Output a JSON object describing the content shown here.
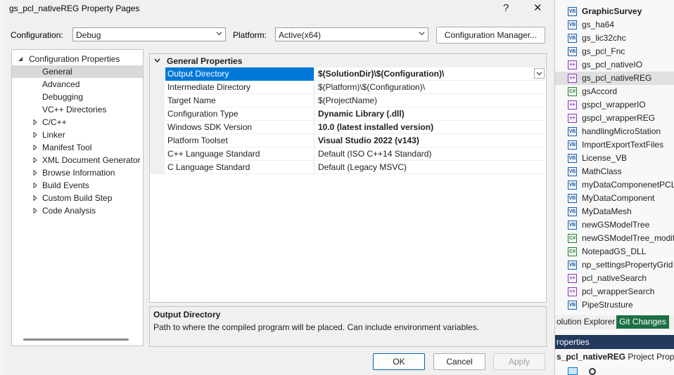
{
  "dialog": {
    "title": "gs_pcl_nativeREG Property Pages",
    "help": "?",
    "close": "✕",
    "configuration_label": "Configuration:",
    "configuration_value": "Debug",
    "platform_label": "Platform:",
    "platform_value": "Active(x64)",
    "config_manager": "Configuration Manager...",
    "ok": "OK",
    "cancel": "Cancel",
    "apply": "Apply"
  },
  "tree": {
    "root": "Configuration Properties",
    "items": [
      {
        "label": "General",
        "expandable": false,
        "selected": true
      },
      {
        "label": "Advanced",
        "expandable": false
      },
      {
        "label": "Debugging",
        "expandable": false
      },
      {
        "label": "VC++ Directories",
        "expandable": false
      },
      {
        "label": "C/C++",
        "expandable": true
      },
      {
        "label": "Linker",
        "expandable": true
      },
      {
        "label": "Manifest Tool",
        "expandable": true
      },
      {
        "label": "XML Document Generator",
        "expandable": true
      },
      {
        "label": "Browse Information",
        "expandable": true
      },
      {
        "label": "Build Events",
        "expandable": true
      },
      {
        "label": "Custom Build Step",
        "expandable": true
      },
      {
        "label": "Code Analysis",
        "expandable": true
      }
    ]
  },
  "grid": {
    "section": "General Properties",
    "rows": [
      {
        "name": "Output Directory",
        "value": "$(SolutionDir)\\$(Configuration)\\",
        "bold": true,
        "selected": true
      },
      {
        "name": "Intermediate Directory",
        "value": "$(Platform)\\$(Configuration)\\",
        "bold": false
      },
      {
        "name": "Target Name",
        "value": "$(ProjectName)",
        "bold": false
      },
      {
        "name": "Configuration Type",
        "value": "Dynamic Library (.dll)",
        "bold": true
      },
      {
        "name": "Windows SDK Version",
        "value": "10.0 (latest installed version)",
        "bold": true
      },
      {
        "name": "Platform Toolset",
        "value": "Visual Studio 2022 (v143)",
        "bold": true
      },
      {
        "name": "C++ Language Standard",
        "value": "Default (ISO C++14 Standard)",
        "bold": false
      },
      {
        "name": "C Language Standard",
        "value": "Default (Legacy MSVC)",
        "bold": false
      }
    ]
  },
  "description": {
    "title": "Output Directory",
    "text": "Path to where the compiled program will be placed. Can include environment variables."
  },
  "solution": {
    "items": [
      {
        "icon": "vb",
        "label": "GraphicSurvey",
        "bold": true
      },
      {
        "icon": "vb",
        "label": "gs_ha64"
      },
      {
        "icon": "vb",
        "label": "gs_lic32chc"
      },
      {
        "icon": "vb",
        "label": "gs_pcl_Fnc"
      },
      {
        "icon": "cpp",
        "label": "gs_pcl_nativeIO"
      },
      {
        "icon": "cpp",
        "label": "gs_pcl_nativeREG",
        "selected": true
      },
      {
        "icon": "cs",
        "label": "gsAccord"
      },
      {
        "icon": "cpp",
        "label": "gspcl_wrapperIO"
      },
      {
        "icon": "cpp",
        "label": "gspcl_wrapperREG"
      },
      {
        "icon": "vb",
        "label": "handlingMicroStation"
      },
      {
        "icon": "vb",
        "label": "ImportExportTextFiles"
      },
      {
        "icon": "vb",
        "label": "License_VB"
      },
      {
        "icon": "vb",
        "label": "MathClass"
      },
      {
        "icon": "vb",
        "label": "myDataComponenetPCL"
      },
      {
        "icon": "vb",
        "label": "MyDataComponent"
      },
      {
        "icon": "vb",
        "label": "MyDataMesh"
      },
      {
        "icon": "vb",
        "label": "newGSModelTree"
      },
      {
        "icon": "cs",
        "label": "newGSModelTree_modify"
      },
      {
        "icon": "cs",
        "label": "NotepadGS_DLL"
      },
      {
        "icon": "vb",
        "label": "np_settingsPropertyGrid"
      },
      {
        "icon": "cpp",
        "label": "pcl_nativeSearch"
      },
      {
        "icon": "cpp",
        "label": "pcl_wrapperSearch"
      },
      {
        "icon": "vb",
        "label": "PipeStrusture"
      }
    ],
    "icon_text": {
      "vb": "VB",
      "cs": "C#",
      "cpp": "++"
    },
    "tab_solution": "olution Explorer",
    "tab_git": "Git Changes",
    "properties_title": "roperties",
    "selected_name": "s_pcl_nativeREG",
    "selected_type": "Project Proper"
  },
  "colors": {
    "selection_blue": "#0078d7",
    "git_tab_green": "#1c6f44",
    "properties_bar": "#23395d"
  }
}
